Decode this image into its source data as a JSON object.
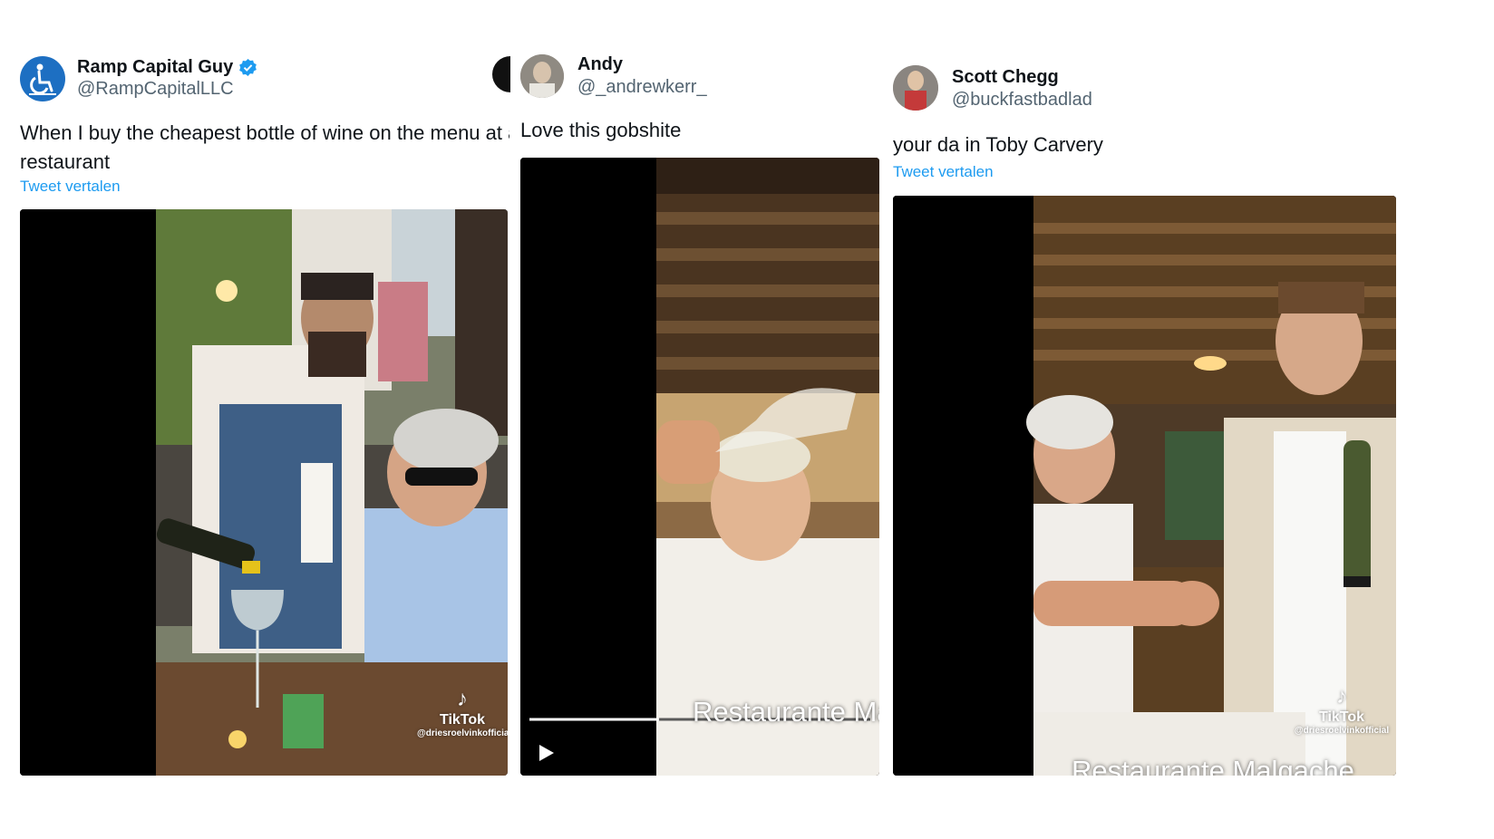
{
  "tweets": [
    {
      "name": "Ramp Capital Guy",
      "handle": "@RampCapitalLLC",
      "verified": true,
      "text_line1": "When I buy the cheapest bottle of wine on the menu at an",
      "text_line2": "restaurant",
      "translate": "Tweet vertalen",
      "avatar_icon": "wheelchair-icon",
      "tiktok": {
        "word": "TikTok",
        "user": "@driesroelvinkofficial"
      }
    },
    {
      "name": "Andy",
      "handle": "@_andrewkerr_",
      "text_line1": "Love this gobshite",
      "video_caption": "Restaurante Ma",
      "progress": 0.38
    },
    {
      "name": "Scott Chegg",
      "handle": "@buckfastbadlad",
      "text_line1": "your da in Toby Carvery",
      "translate": "Tweet vertalen",
      "video_caption": "Restaurante Malgache",
      "tiktok": {
        "word": "TikTok",
        "user": "@driesroelvinkofficial"
      }
    }
  ],
  "colors": {
    "link": "#1d9bf0",
    "verified": "#1d9bf0",
    "handle": "#536471"
  }
}
